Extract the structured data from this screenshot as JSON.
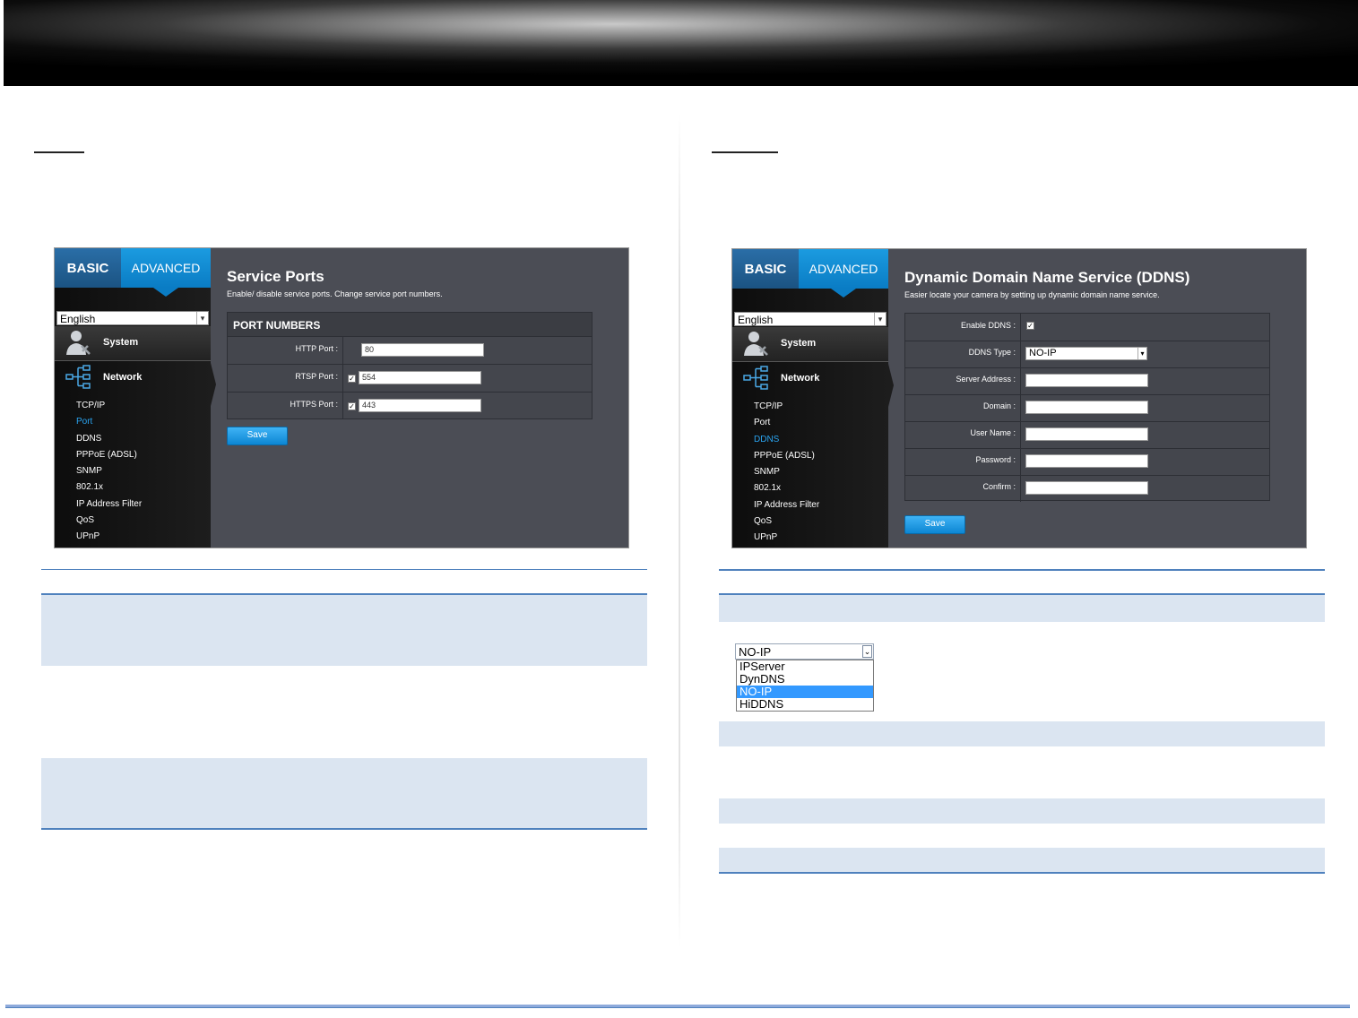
{
  "left_panel": {
    "tabs": {
      "basic": "BASIC",
      "advanced": "ADVANCED"
    },
    "language": "English",
    "system_label": "System",
    "network_label": "Network",
    "menu": [
      "TCP/IP",
      "Port",
      "DDNS",
      "PPPoE (ADSL)",
      "SNMP",
      "802.1x",
      "IP Address Filter",
      "QoS",
      "UPnP"
    ],
    "active_menu": "Port",
    "title": "Service Ports",
    "description": "Enable/ disable service ports. Change service port numbers.",
    "section_header": "PORT NUMBERS",
    "rows": [
      {
        "label": "HTTP Port :",
        "value": "80",
        "checked": false
      },
      {
        "label": "RTSP Port :",
        "value": "554",
        "checked": true
      },
      {
        "label": "HTTPS Port :",
        "value": "443",
        "checked": true
      }
    ],
    "save": "Save"
  },
  "right_panel": {
    "tabs": {
      "basic": "BASIC",
      "advanced": "ADVANCED"
    },
    "language": "English",
    "system_label": "System",
    "network_label": "Network",
    "menu": [
      "TCP/IP",
      "Port",
      "DDNS",
      "PPPoE (ADSL)",
      "SNMP",
      "802.1x",
      "IP Address Filter",
      "QoS",
      "UPnP"
    ],
    "active_menu": "DDNS",
    "title": "Dynamic Domain Name Service (DDNS)",
    "description": "Easier locate your camera by setting up dynamic domain name service.",
    "rows": [
      {
        "label": "Enable DDNS :",
        "type": "checkbox",
        "checked": true
      },
      {
        "label": "DDNS Type :",
        "type": "select",
        "value": "NO-IP"
      },
      {
        "label": "Server Address :",
        "type": "text",
        "value": ""
      },
      {
        "label": "Domain :",
        "type": "text",
        "value": ""
      },
      {
        "label": "User Name :",
        "type": "text",
        "value": ""
      },
      {
        "label": "Password :",
        "type": "text",
        "value": ""
      },
      {
        "label": "Confirm :",
        "type": "text",
        "value": ""
      }
    ],
    "save": "Save"
  },
  "ddns_dropdown": {
    "selected": "NO-IP",
    "options": [
      "IPServer",
      "DynDNS",
      "NO-IP",
      "HiDDNS"
    ],
    "highlighted": "NO-IP"
  },
  "colors": {
    "accent": "#0a7cc4",
    "active_menu": "#2aa3ef",
    "table_shade": "#dbe5f1",
    "rule": "#4f81bd"
  }
}
